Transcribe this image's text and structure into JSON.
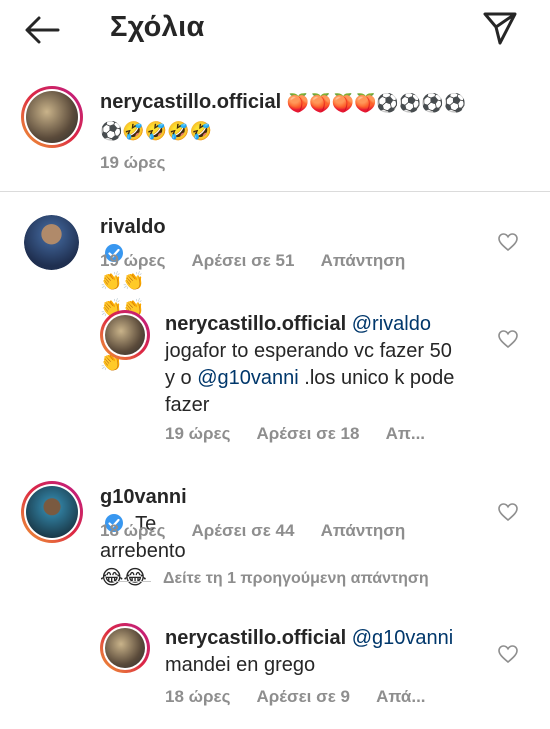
{
  "header": {
    "title": "Σχόλια"
  },
  "post": {
    "username": "nerycastillo.official",
    "emojis_line1": "🍑🍑🍑🍑⚽⚽⚽⚽",
    "emojis_line2": "⚽🤣🤣🤣🤣",
    "time": "19 ώρες"
  },
  "comments": [
    {
      "username": "rivaldo",
      "text": "👏👏👏👏👏👏👏",
      "time": "19 ώρες",
      "likes": "Αρέσει σε 51",
      "reply": "Απάντηση"
    },
    {
      "username": "nerycastillo.official",
      "mention": "@rivaldo",
      "text_line1": "jogafor to esperando vc fazer 50",
      "text_line2a": "y o ",
      "mention2": "@g10vanni",
      "text_line2b": " .los unico k pode",
      "text_line3": "fazer",
      "time": "19 ώρες",
      "likes": "Αρέσει σε 18",
      "reply": "Απ..."
    },
    {
      "username": "g10vanni",
      "text": "Te arrebento 😂😂",
      "time": "18 ώρες",
      "likes": "Αρέσει σε 44",
      "reply": "Απάντηση"
    },
    {
      "view_previous": "Δείτε τη 1 προηγούμενη απάντηση"
    },
    {
      "username": "nerycastillo.official",
      "mention": "@g10vanni",
      "text_line2": "mandei en grego",
      "time": "18 ώρες",
      "likes": "Αρέσει σε 9",
      "reply": "Απά..."
    }
  ],
  "colors": {
    "text": "#262626",
    "meta": "#8e8e8e",
    "mention": "#00376b",
    "verified": "#3897f0"
  }
}
